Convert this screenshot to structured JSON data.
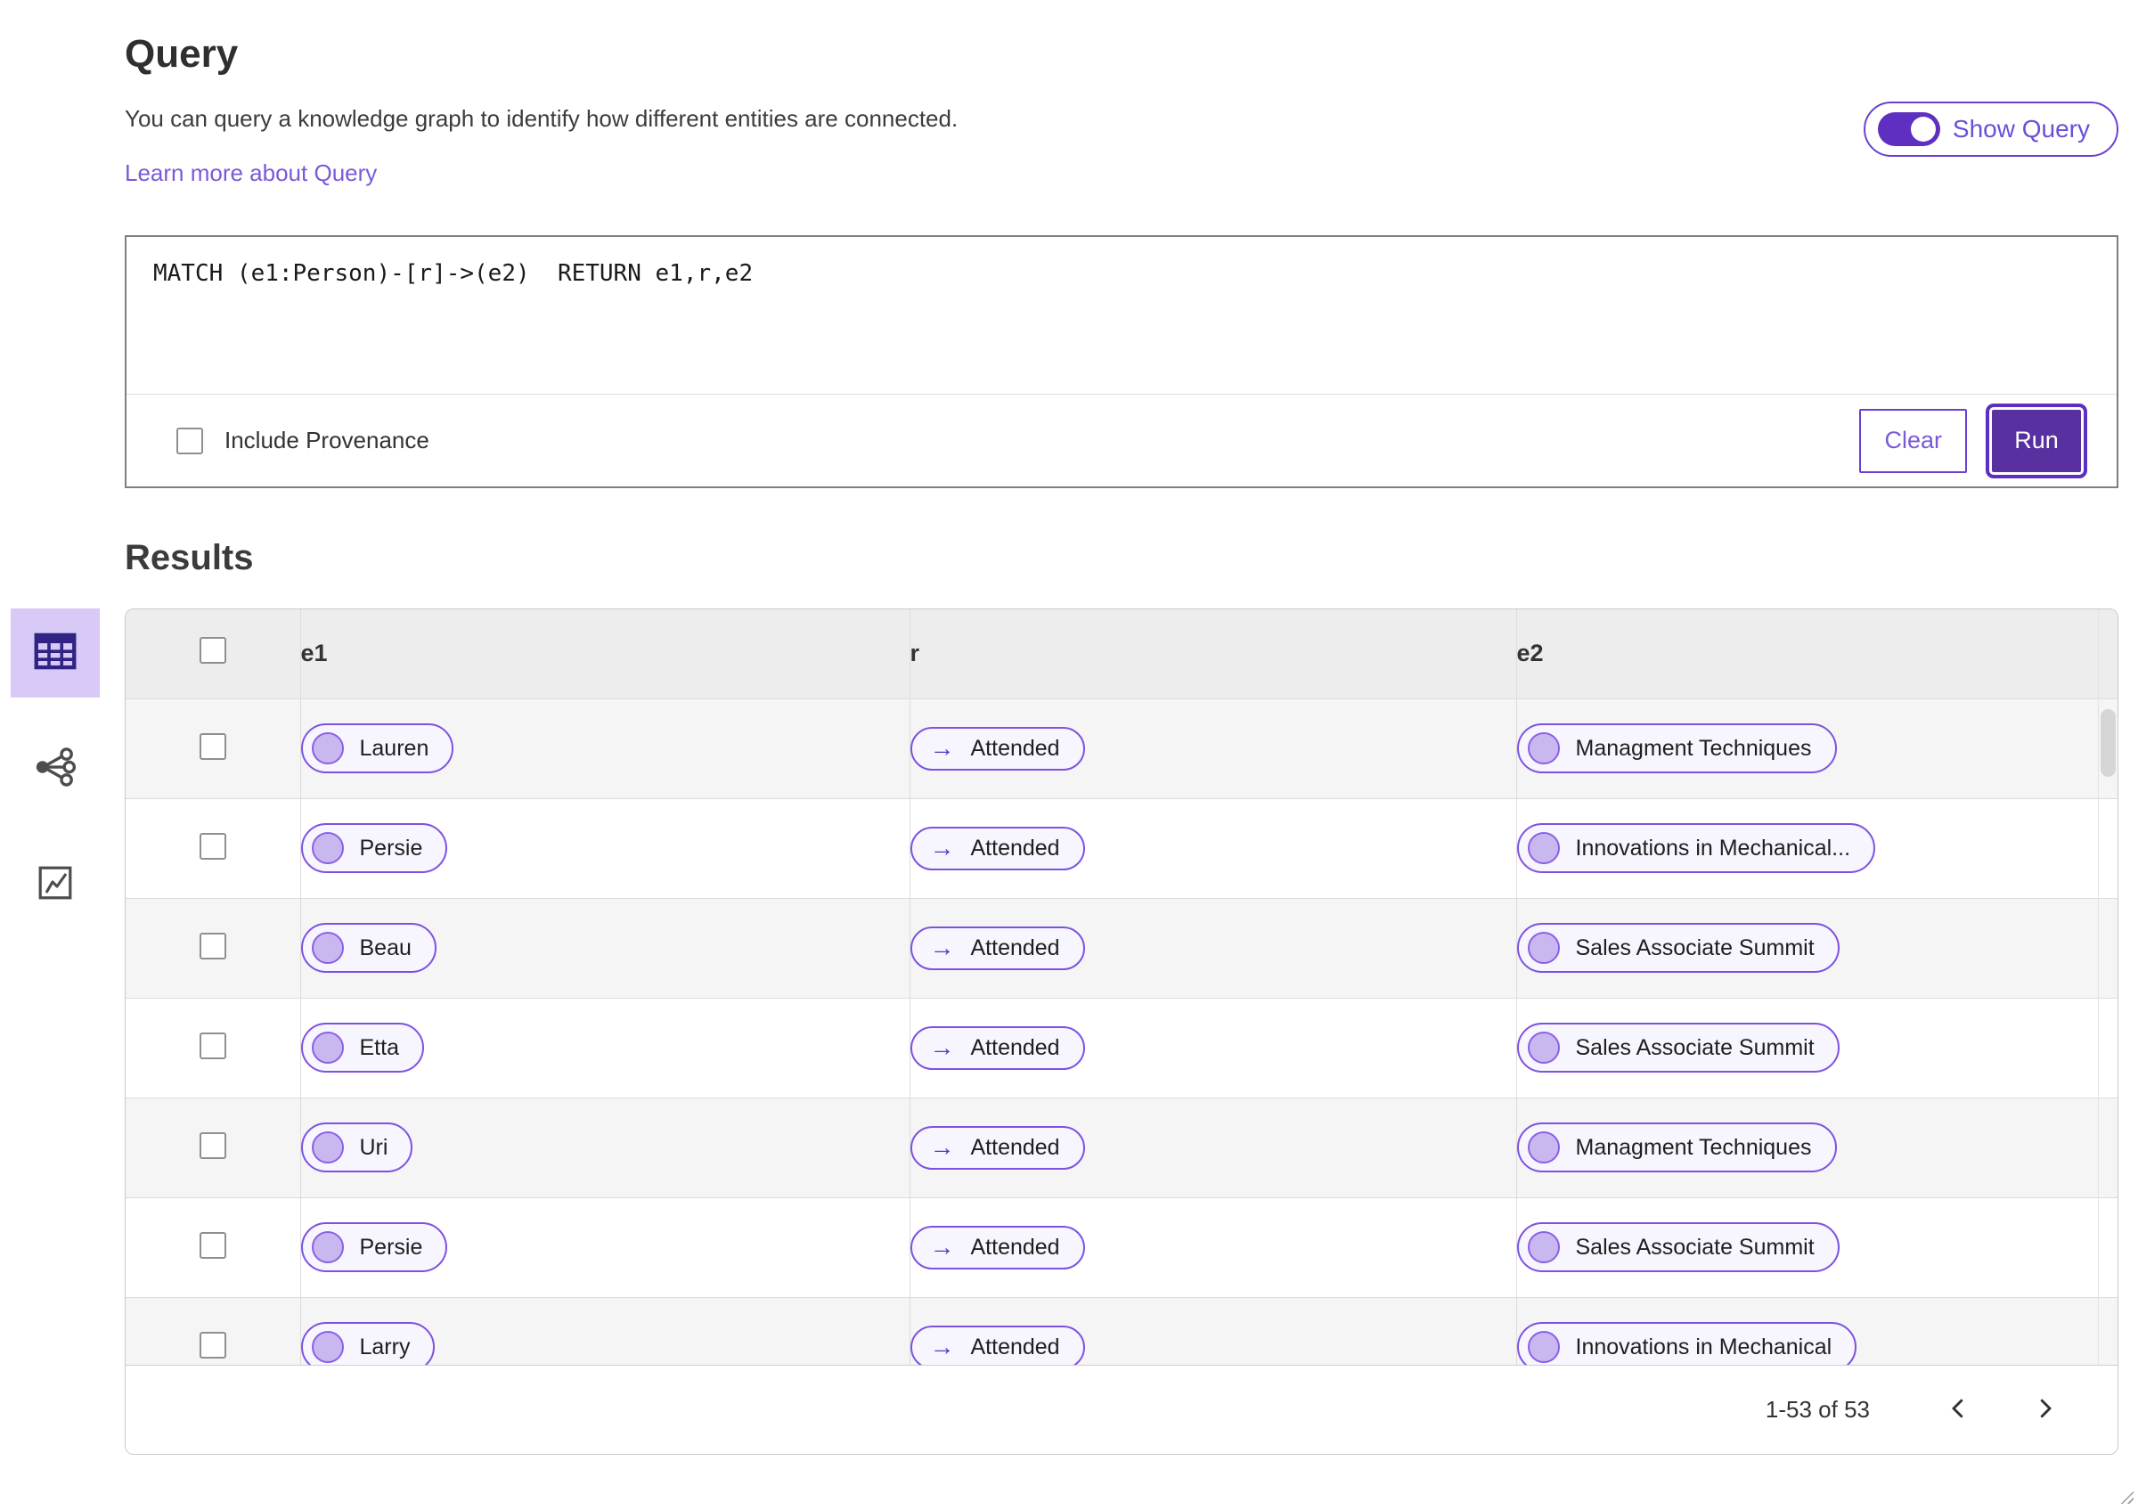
{
  "query_section": {
    "title": "Query",
    "description": "You can query a knowledge graph to identify how different entities are connected.",
    "learn_more_link": "Learn more about Query",
    "show_query_toggle": {
      "label": "Show Query",
      "state": "on"
    },
    "query_input": {
      "value": "MATCH (e1:Person)-[r]->(e2)  RETURN e1,r,e2"
    },
    "include_provenance": {
      "label": "Include Provenance",
      "checked": false
    },
    "buttons": {
      "clear": "Clear",
      "run": "Run"
    }
  },
  "results_section": {
    "title": "Results",
    "view_switcher": [
      {
        "name": "table-view",
        "selected": true
      },
      {
        "name": "graph-view",
        "selected": false
      },
      {
        "name": "chart-view",
        "selected": false
      }
    ],
    "table": {
      "columns": [
        "e1",
        "r",
        "e2"
      ],
      "rows": [
        {
          "e1": "Lauren",
          "r": "Attended",
          "e2": "Managment Techniques"
        },
        {
          "e1": "Persie",
          "r": "Attended",
          "e2": "Innovations in Mechanical..."
        },
        {
          "e1": "Beau",
          "r": "Attended",
          "e2": "Sales Associate Summit"
        },
        {
          "e1": "Etta",
          "r": "Attended",
          "e2": "Sales Associate Summit"
        },
        {
          "e1": "Uri",
          "r": "Attended",
          "e2": "Managment Techniques"
        },
        {
          "e1": "Persie",
          "r": "Attended",
          "e2": "Sales Associate Summit"
        },
        {
          "e1": "Larry",
          "r": "Attended",
          "e2": "Innovations in Mechanical"
        }
      ]
    },
    "pagination": {
      "range_label": "1-53 of 53"
    }
  },
  "icons": {
    "relation_arrow": "→"
  },
  "colors": {
    "accent_purple": "#6b3fd4",
    "run_button_bg": "#59309f",
    "pill_border": "#7e52e0",
    "pill_bg": "#f7f5fe",
    "entity_dot_fill": "#c9b7ef",
    "selected_view_bg": "#d8c9f6",
    "selected_view_icon": "#2f2483",
    "link_color": "#7a5ad8",
    "table_header_bg": "#ededed",
    "zebra_row_bg": "#f5f5f5"
  }
}
